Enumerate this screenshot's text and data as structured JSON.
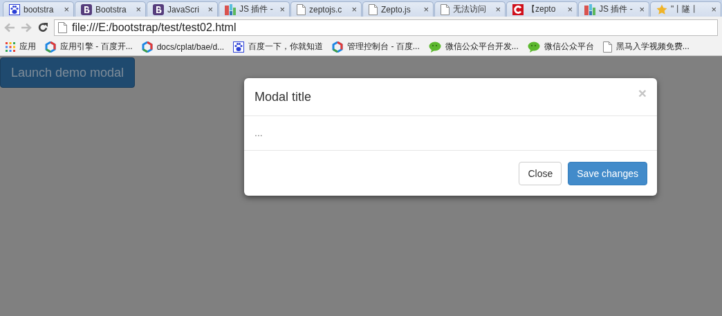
{
  "tabs": [
    {
      "title": "bootstra",
      "kind": "paw",
      "close_glyph": "×"
    },
    {
      "title": "Bootstra",
      "kind": "letter-b",
      "close_glyph": "×"
    },
    {
      "title": "JavaScri",
      "kind": "letter-b",
      "close_glyph": "×"
    },
    {
      "title": "JS 插件 -",
      "kind": "bars",
      "close_glyph": "×"
    },
    {
      "title": "zeptojs.c",
      "kind": "page",
      "close_glyph": "×"
    },
    {
      "title": "Zepto.js",
      "kind": "page",
      "close_glyph": "×"
    },
    {
      "title": "无法访问",
      "kind": "page",
      "close_glyph": "×"
    },
    {
      "title": "【zepto",
      "kind": "letter-c",
      "close_glyph": "×"
    },
    {
      "title": "JS 插件 -",
      "kind": "bars",
      "close_glyph": "×"
    },
    {
      "title": "\"丨隧丨",
      "kind": "star",
      "close_glyph": "×"
    }
  ],
  "address_bar": {
    "value": "file:///E:/bootstrap/test/test02.html"
  },
  "bookmarks": [
    {
      "label": "应用",
      "kind": "apps"
    },
    {
      "label": "应用引擎 - 百度开...",
      "kind": "hexagon"
    },
    {
      "label": "docs/cplat/bae/d...",
      "kind": "hexagon"
    },
    {
      "label": "百度一下，你就知道",
      "kind": "paw"
    },
    {
      "label": "管理控制台 - 百度...",
      "kind": "hexagon"
    },
    {
      "label": "微信公众平台开发...",
      "kind": "chat"
    },
    {
      "label": "微信公众平台",
      "kind": "chat"
    },
    {
      "label": "黑马入学视频免费...",
      "kind": "page"
    }
  ],
  "page": {
    "launch_button": "Launch demo modal"
  },
  "modal": {
    "title": "Modal title",
    "close_glyph": "×",
    "body": "...",
    "buttons": [
      {
        "label": "Close",
        "kind": "default"
      },
      {
        "label": "Save changes",
        "kind": "primary"
      }
    ]
  }
}
